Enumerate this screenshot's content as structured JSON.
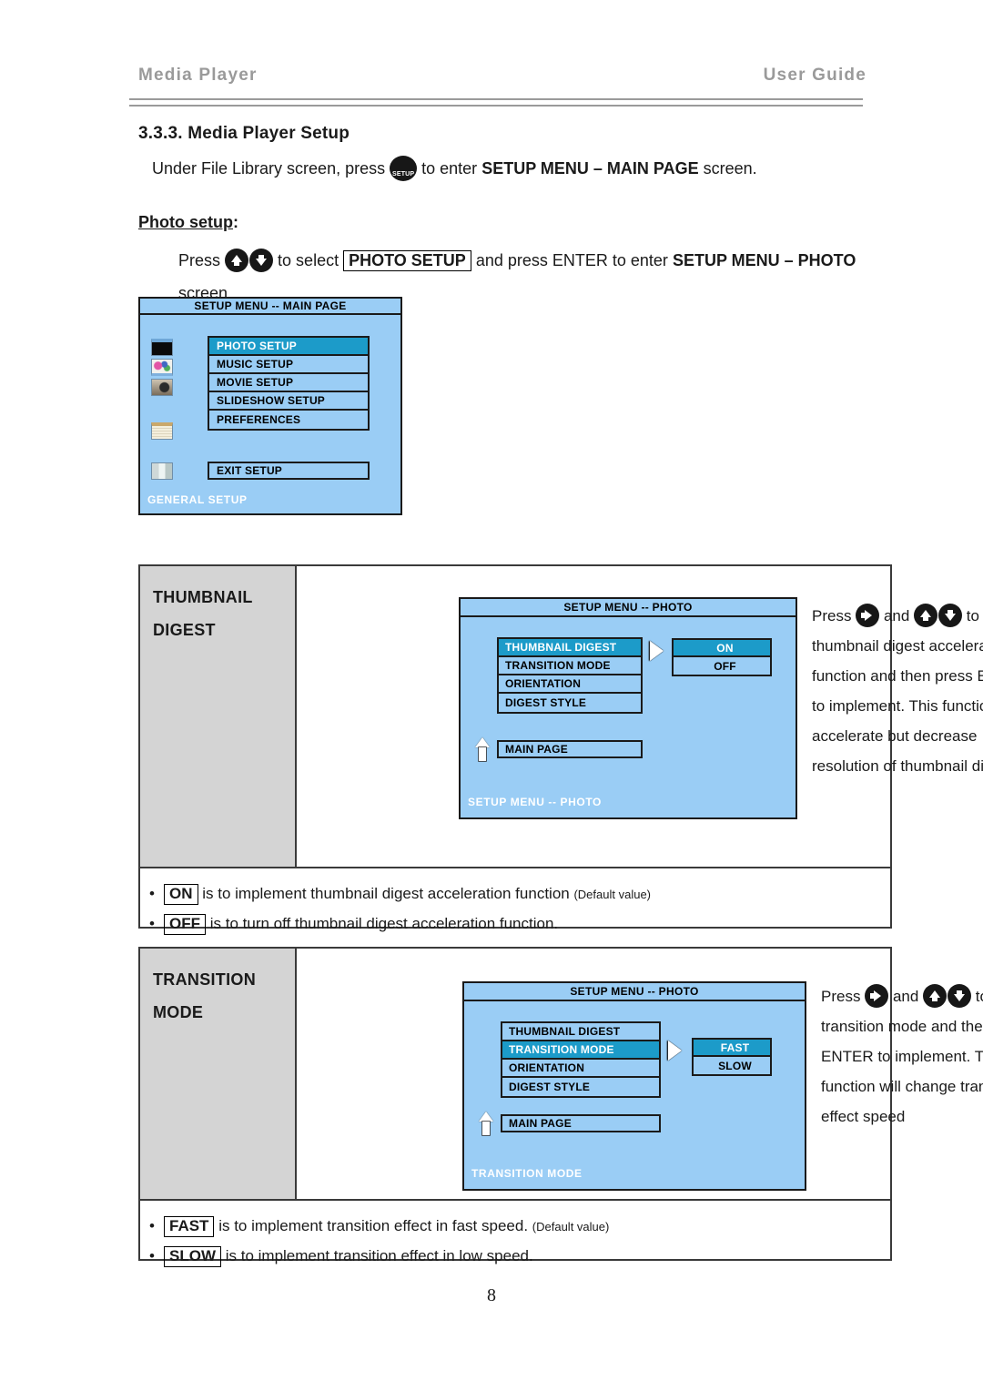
{
  "header": {
    "left_title": "Media Player",
    "right_title": "User Guide"
  },
  "section_heading": "3.3.3. Media Player Setup",
  "intro": {
    "before_icon": "Under File Library screen, press",
    "setup_button_label": "SETUP",
    "after_icon": "to enter",
    "bold_target": "SETUP MENU – MAIN PAGE",
    "tail": "screen."
  },
  "photo_setup": {
    "heading_underlined": "Photo setup",
    "heading_colon": ":",
    "press_word": "Press",
    "to_select": "to select",
    "boxed_item": "PHOTO SETUP",
    "and_press": "and press ENTER to enter",
    "bold_target": "SETUP MENU –",
    "line2_bold": "PHOTO",
    "line2_tail": "screen."
  },
  "osd_main": {
    "title": "SETUP MENU -- MAIN PAGE",
    "items": [
      {
        "label": "PHOTO SETUP",
        "selected": true
      },
      {
        "label": "MUSIC SETUP",
        "selected": false
      },
      {
        "label": "MOVIE SETUP",
        "selected": false
      },
      {
        "label": "SLIDESHOW SETUP",
        "selected": false
      },
      {
        "label": "PREFERENCES",
        "selected": false
      }
    ],
    "exit_label": "EXIT SETUP",
    "footer": "GENERAL SETUP",
    "icons": [
      "photo-thumbnail-icon",
      "music-note-icon",
      "movie-camera-icon",
      "document-icon",
      "exit-door-icon"
    ]
  },
  "sections": [
    {
      "label_line1": "THUMBNAIL",
      "label_line2": "DIGEST",
      "osd": {
        "title": "SETUP MENU -- PHOTO",
        "items": [
          {
            "label": "THUMBNAIL DIGEST",
            "selected": true
          },
          {
            "label": "TRANSITION MODE",
            "selected": false
          },
          {
            "label": "ORIENTATION",
            "selected": false
          },
          {
            "label": "DIGEST STYLE",
            "selected": false
          }
        ],
        "main_page_label": "MAIN PAGE",
        "options": [
          {
            "label": "ON",
            "selected": true
          },
          {
            "label": "OFF",
            "selected": false
          }
        ],
        "footer": "SETUP MENU -- PHOTO"
      },
      "description": {
        "press": "Press",
        "and": "and",
        "to": "to",
        "body": "select thumbnail digest acceleration function and then press ENTER to implement. This function will accelerate but decrease resolution of thumbnail digest."
      },
      "notes": [
        {
          "boxed": "ON",
          "text": "is to implement thumbnail digest acceleration function",
          "suffix": "(Default value)"
        },
        {
          "boxed": "OFF",
          "text": "is to turn off thumbnail digest acceleration function.",
          "suffix": ""
        }
      ]
    },
    {
      "label_line1": "TRANSITION",
      "label_line2": "MODE",
      "osd": {
        "title": "SETUP MENU -- PHOTO",
        "items": [
          {
            "label": "THUMBNAIL DIGEST",
            "selected": false
          },
          {
            "label": "TRANSITION MODE",
            "selected": true
          },
          {
            "label": "ORIENTATION",
            "selected": false
          },
          {
            "label": "DIGEST STYLE",
            "selected": false
          }
        ],
        "main_page_label": "MAIN PAGE",
        "options": [
          {
            "label": "FAST",
            "selected": true
          },
          {
            "label": "SLOW",
            "selected": false
          }
        ],
        "footer": "TRANSITION MODE"
      },
      "description": {
        "press": "Press",
        "and": "and",
        "to": "to",
        "body": "select transition mode and then press ENTER to implement. This function will change transition effect speed"
      },
      "notes": [
        {
          "boxed": "FAST",
          "text": "is to implement transition effect in fast speed.",
          "suffix": "(Default value)"
        },
        {
          "boxed": "SLOW",
          "text": "is to implement transition effect in low speed.",
          "suffix": ""
        }
      ]
    }
  ],
  "page_number": "8",
  "colors": {
    "osd_background": "#9ACDF5",
    "osd_highlight": "#1C9BC9",
    "section_label_bg": "#D4D4D4",
    "header_text": "#9A9A9A"
  }
}
